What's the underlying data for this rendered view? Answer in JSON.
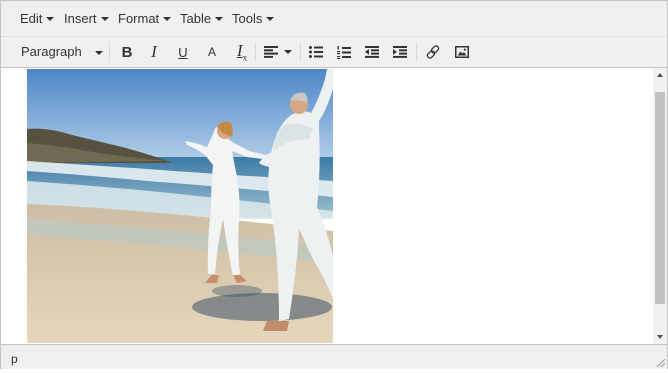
{
  "menubar": {
    "items": [
      {
        "label": "Edit"
      },
      {
        "label": "Insert"
      },
      {
        "label": "Format"
      },
      {
        "label": "Table"
      },
      {
        "label": "Tools"
      }
    ]
  },
  "toolbar": {
    "format_select_value": "Paragraph",
    "bold_label": "B",
    "italic_label": "I",
    "underline_label": "U",
    "font_size_label": "A",
    "clear_format_label": "I",
    "clear_format_sub": "x",
    "icons": [
      "bold-icon",
      "italic-icon",
      "underline-icon",
      "font-size-icon",
      "clear-formatting-icon",
      "align-left-icon",
      "bullet-list-icon",
      "numbered-list-icon",
      "outdent-icon",
      "indent-icon",
      "link-icon",
      "image-icon"
    ]
  },
  "content": {
    "image": "beach-couple-photo"
  },
  "statusbar": {
    "path": "p"
  },
  "colors": {
    "bar_bg": "#f0f0f0",
    "border": "#c5c5c5",
    "text": "#333333"
  }
}
